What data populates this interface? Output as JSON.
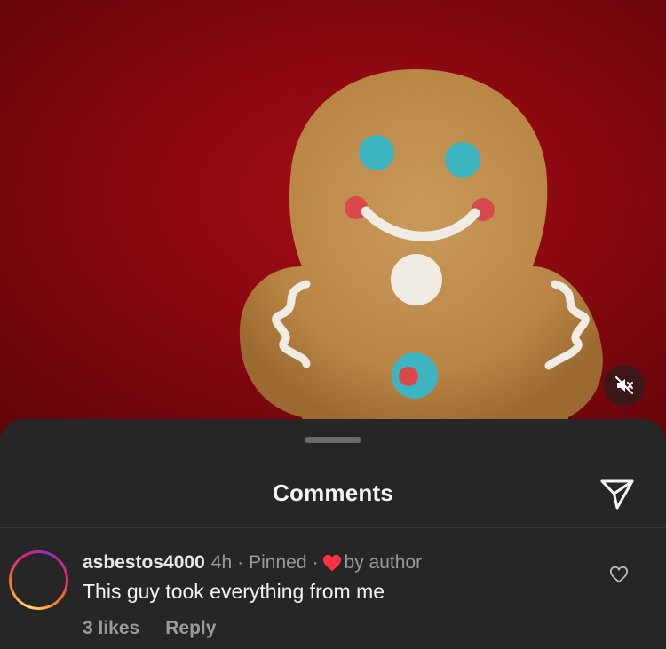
{
  "video": {
    "mute_icon": "speaker-muted-icon"
  },
  "sheet": {
    "title": "Comments",
    "share_icon": "paper-plane-icon"
  },
  "comment": {
    "username": "asbestos4000",
    "time": "4h",
    "separator": "·",
    "pinned": "Pinned",
    "author_like_label": "by author",
    "author_heart_color": "#ff3040",
    "text": "This guy took everything from me",
    "likes": "3 likes",
    "reply": "Reply",
    "like_icon": "heart-outline-icon"
  },
  "colors": {
    "sheet_bg": "#262626",
    "video_bg": "#8a0810",
    "text_primary": "#f2f2f2",
    "text_muted": "#9a9a9a"
  }
}
